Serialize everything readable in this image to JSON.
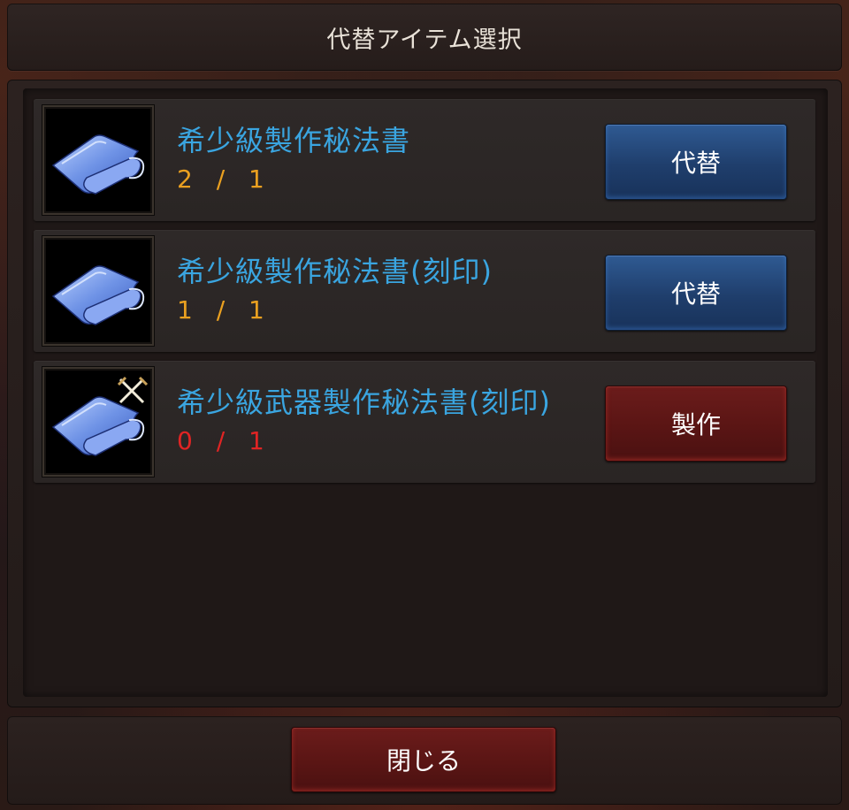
{
  "window": {
    "title": "代替アイテム選択"
  },
  "items": [
    {
      "name": "希少級製作秘法書",
      "count": "2 / 1",
      "count_status": "ok",
      "icon": "blue-scroll-icon",
      "badge": null,
      "action_label": "代替",
      "action_color": "blue"
    },
    {
      "name": "希少級製作秘法書(刻印)",
      "count": "1 / 1",
      "count_status": "ok",
      "icon": "blue-scroll-icon",
      "badge": null,
      "action_label": "代替",
      "action_color": "blue"
    },
    {
      "name": "希少級武器製作秘法書(刻印)",
      "count": "0 / 1",
      "count_status": "insufficient",
      "icon": "blue-scroll-icon",
      "badge": "crossed-swords-icon",
      "action_label": "製作",
      "action_color": "red"
    }
  ],
  "footer": {
    "close_label": "閉じる"
  },
  "colors": {
    "item_name": "#3aa5e0",
    "count_ok": "#eaa020",
    "count_insufficient": "#e02424",
    "button_blue": "#1f3e6c",
    "button_red": "#5a1514"
  }
}
